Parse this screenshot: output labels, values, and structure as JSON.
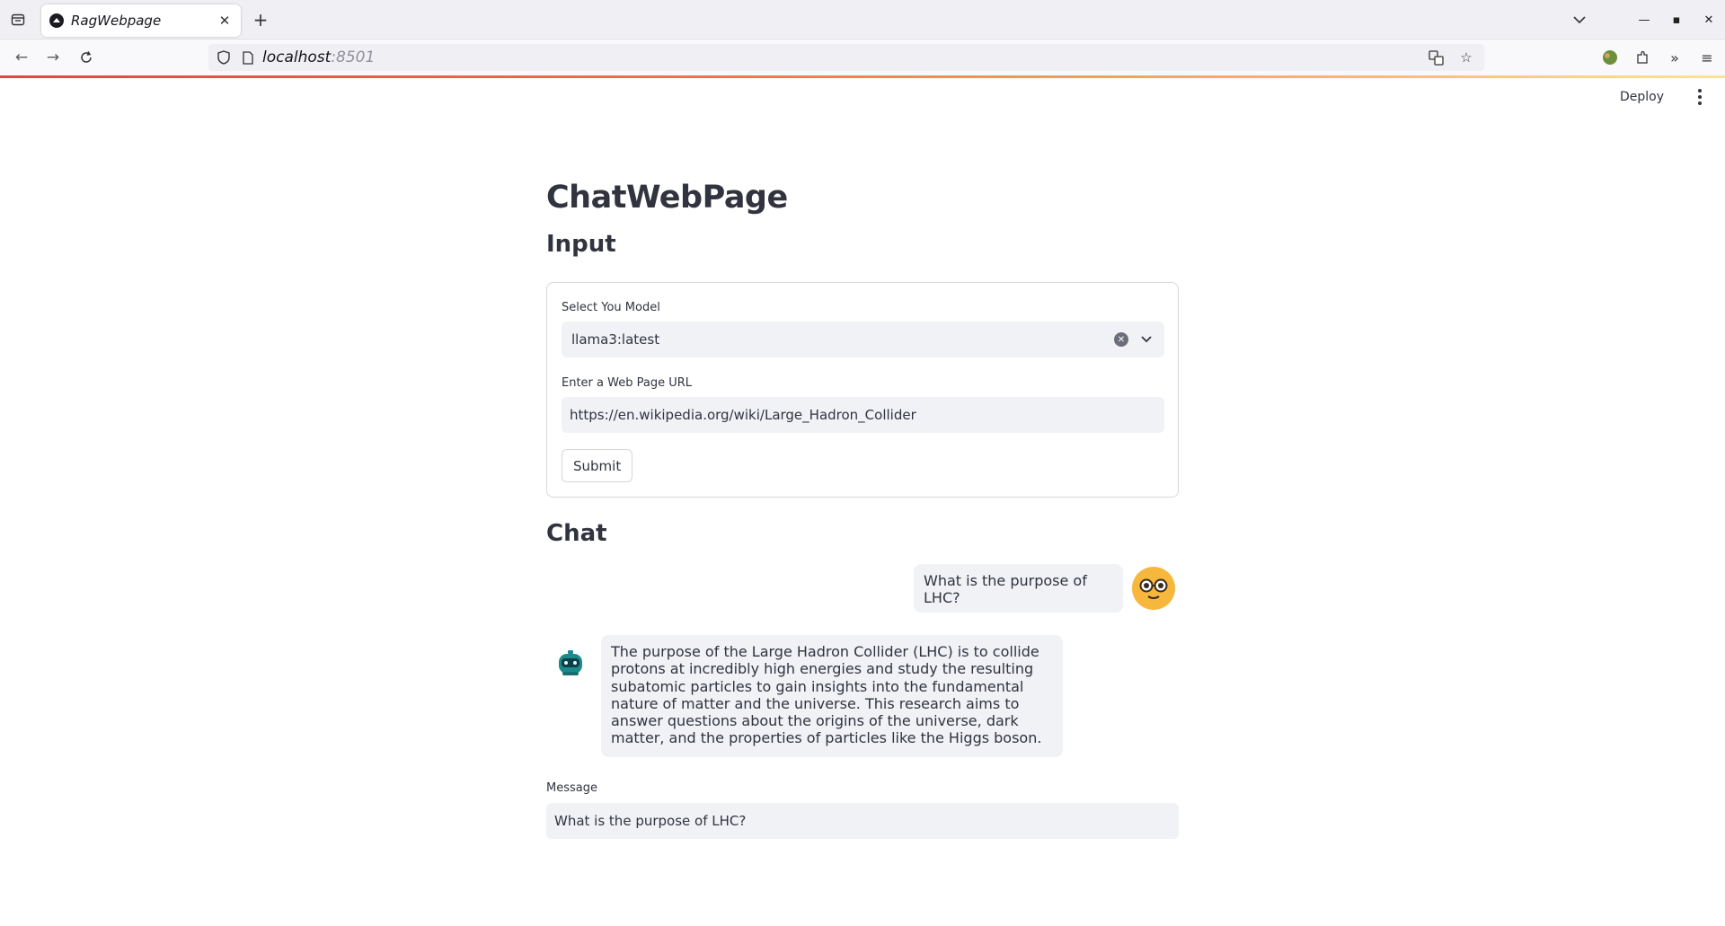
{
  "browser": {
    "tab_title": "RagWebpage",
    "url_host": "localhost",
    "url_port": ":8501"
  },
  "app": {
    "deploy_label": "Deploy",
    "title": "ChatWebPage",
    "input_heading": "Input",
    "model_label": "Select You Model",
    "model_value": "llama3:latest",
    "url_label": "Enter a Web Page URL",
    "url_value": "https://en.wikipedia.org/wiki/Large_Hadron_Collider",
    "submit_label": "Submit",
    "chat_heading": "Chat",
    "messages": [
      {
        "role": "user",
        "text": "What is the purpose of LHC?"
      },
      {
        "role": "assistant",
        "text": "The purpose of the Large Hadron Collider (LHC) is to collide protons at incredibly high energies and study the resulting subatomic particles to gain insights into the fundamental nature of matter and the universe. This research aims to answer questions about the origins of the universe, dark matter, and the properties of particles like the Higgs boson."
      }
    ],
    "message_label": "Message",
    "message_value": "What is the purpose of LHC?"
  }
}
